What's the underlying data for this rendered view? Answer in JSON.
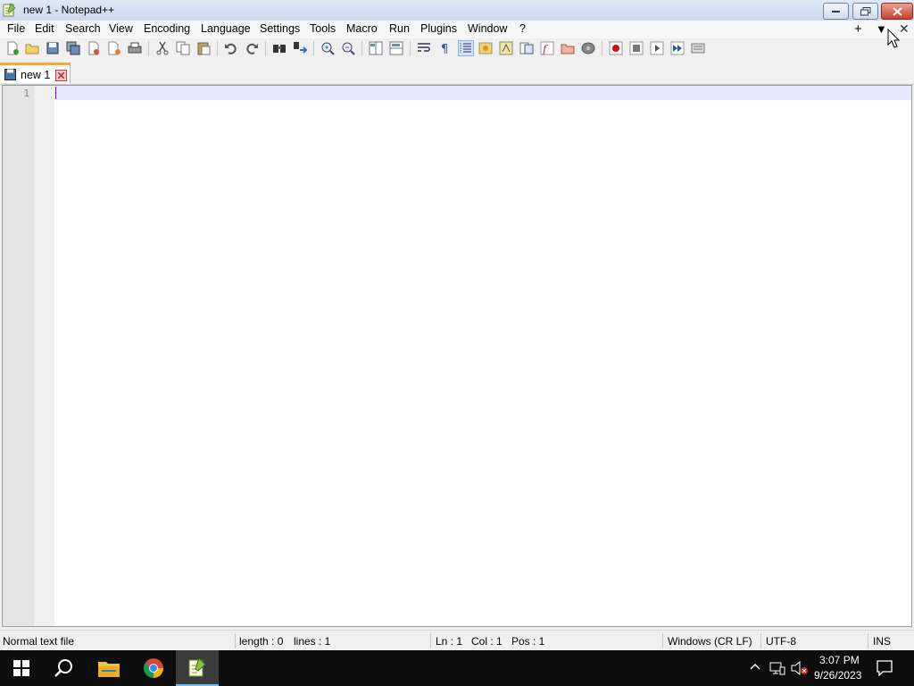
{
  "window": {
    "title": "new 1 - Notepad++"
  },
  "menu": {
    "items": [
      "File",
      "Edit",
      "Search",
      "View",
      "Encoding",
      "Language",
      "Settings",
      "Tools",
      "Macro",
      "Run",
      "Plugins",
      "Window",
      "?"
    ],
    "right_plus": "+",
    "right_dropdown": "▼",
    "right_close": "✕"
  },
  "toolbar": {
    "icons": [
      "new-file-icon",
      "open-file-icon",
      "save-icon",
      "save-all-icon",
      "close-icon",
      "close-all-icon",
      "print-icon",
      "cut-icon",
      "copy-icon",
      "paste-icon",
      "undo-icon",
      "redo-icon",
      "find-icon",
      "replace-icon",
      "zoom-in-icon",
      "zoom-out-icon",
      "sync-vertical-icon",
      "sync-horizontal-icon",
      "word-wrap-icon",
      "show-all-chars-icon",
      "indent-guide-icon",
      "user-language-icon",
      "doc-map-icon",
      "doc-list-icon",
      "function-list-icon",
      "folder-workspace-icon",
      "monitoring-icon",
      "record-macro-icon",
      "stop-record-icon",
      "play-macro-icon",
      "run-macro-multiple-icon",
      "save-macro-icon"
    ],
    "active_icon": "indent-guide-icon"
  },
  "tabs": [
    {
      "label": "new 1"
    }
  ],
  "editor": {
    "line_numbers": [
      "1"
    ],
    "content": ""
  },
  "status": {
    "filetype": "Normal text file",
    "length": "length : 0",
    "lines": "lines : 1",
    "ln": "Ln : 1",
    "col": "Col : 1",
    "pos": "Pos : 1",
    "eol": "Windows (CR LF)",
    "encoding": "UTF-8",
    "mode": "INS"
  },
  "taskbar": {
    "apps": [
      "start-icon",
      "search-icon",
      "file-explorer-icon",
      "chrome-icon",
      "notepadpp-icon"
    ],
    "time": "3:07 PM",
    "date": "9/26/2023"
  },
  "colors": {
    "accent_tab": "#f7a830",
    "current_line": "#e8e8ff",
    "caret": "#8000ff",
    "taskbar": "#0d0d0d"
  }
}
